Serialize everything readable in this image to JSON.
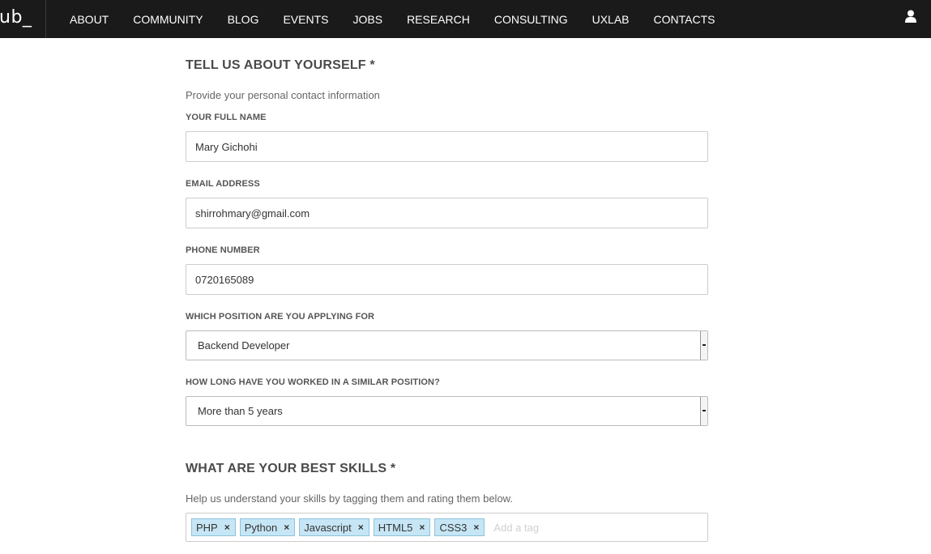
{
  "brand": {
    "logo_text": "ub_"
  },
  "nav": {
    "items": [
      {
        "label": "ABOUT"
      },
      {
        "label": "COMMUNITY"
      },
      {
        "label": "BLOG"
      },
      {
        "label": "EVENTS"
      },
      {
        "label": "JOBS"
      },
      {
        "label": "RESEARCH"
      },
      {
        "label": "CONSULTING"
      },
      {
        "label": "UXLAB"
      },
      {
        "label": "CONTACTS"
      }
    ],
    "user_icon": "user-icon"
  },
  "about": {
    "title": "TELL US ABOUT YOURSELF *",
    "description": "Provide your personal contact information",
    "full_name": {
      "label": "YOUR FULL NAME",
      "value": "Mary Gichohi"
    },
    "email": {
      "label": "EMAIL ADDRESS",
      "value": "shirrohmary@gmail.com"
    },
    "phone": {
      "label": "PHONE NUMBER",
      "value": "0720165089"
    },
    "position": {
      "label": "WHICH POSITION ARE YOU APPLYING FOR",
      "value": "Backend Developer"
    },
    "experience": {
      "label": "HOW LONG HAVE YOU WORKED IN A SIMILAR POSITION?",
      "value": "More than 5 years"
    }
  },
  "skills": {
    "title": "WHAT ARE YOUR BEST SKILLS *",
    "description": "Help us understand your skills by tagging them and rating them below.",
    "tags": [
      "PHP",
      "Python",
      "Javascript",
      "HTML5",
      "CSS3"
    ],
    "remove_glyph": "×",
    "input_placeholder": "Add a tag"
  },
  "colors": {
    "nav_bg": "#1a1a1a",
    "tag_bg": "#c6e6f5",
    "tag_border": "#8fc2dc"
  }
}
